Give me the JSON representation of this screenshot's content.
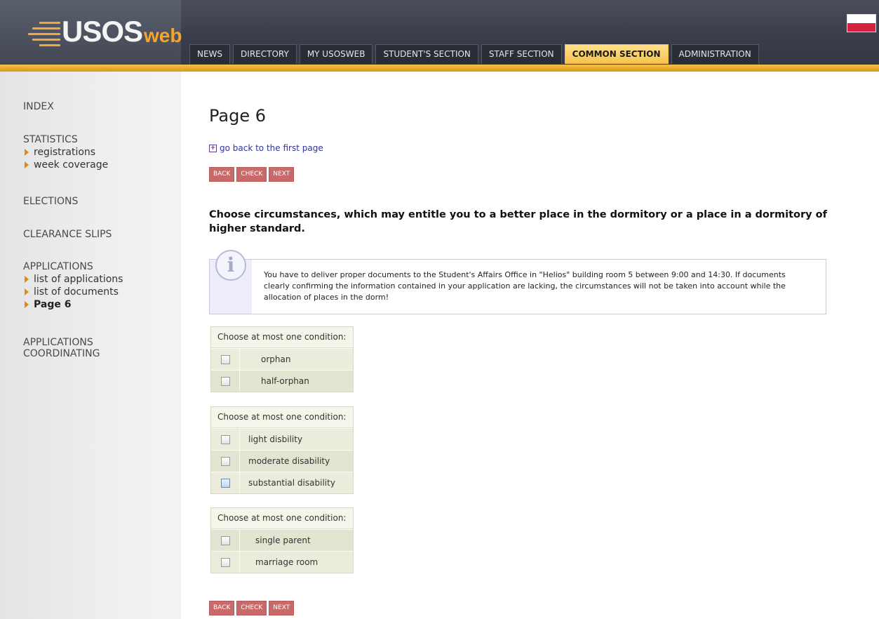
{
  "header": {
    "logo_main": "USOS",
    "logo_suffix": "web",
    "tabs": [
      {
        "label": "NEWS"
      },
      {
        "label": "DIRECTORY"
      },
      {
        "label": "MY USOSWEB"
      },
      {
        "label": "STUDENT'S SECTION"
      },
      {
        "label": "STAFF SECTION"
      },
      {
        "label": "COMMON SECTION",
        "active": true
      },
      {
        "label": "ADMINISTRATION"
      }
    ]
  },
  "sidebar": {
    "index": "INDEX",
    "statistics": {
      "title": "STATISTICS",
      "items": [
        "registrations",
        "week coverage"
      ]
    },
    "elections": "ELECTIONS",
    "clearance_slips": "CLEARANCE SLIPS",
    "applications": {
      "title": "APPLICATIONS",
      "items": [
        "list of applications",
        "list of documents",
        "Page 6"
      ]
    },
    "applications_coordinating": {
      "line1": "APPLICATIONS",
      "line2": "COORDINATING"
    }
  },
  "main": {
    "title": "Page 6",
    "back_link": "go back to the first page",
    "buttons": {
      "back": "BACK",
      "check": "CHECK",
      "next": "NEXT"
    },
    "heading": "Choose circumstances, which may entitle you to a better place in the dormitory or a place in a dormitory of higher standard.",
    "info": "You have to deliver proper documents to the Student's Affairs Office in \"Helios\" building room 5 between 9:00 and 14:30. If documents clearly confirming the information contained in your application are lacking, the circumstances will not be taken into account while the allocation of places in the dorm!",
    "condition_groups": [
      {
        "header": "Choose at most one condition:",
        "options": [
          "orphan",
          "half-orphan"
        ]
      },
      {
        "header": "Choose at most one condition:",
        "options": [
          "light disbility",
          "moderate disability",
          "substantial disability"
        ]
      },
      {
        "header": "Choose at most one condition:",
        "options": [
          "single parent",
          "marriage room"
        ]
      }
    ]
  },
  "colors": {
    "accent": "#f6c24b",
    "button": "#c96a6a",
    "header": "#3a3e4a"
  }
}
